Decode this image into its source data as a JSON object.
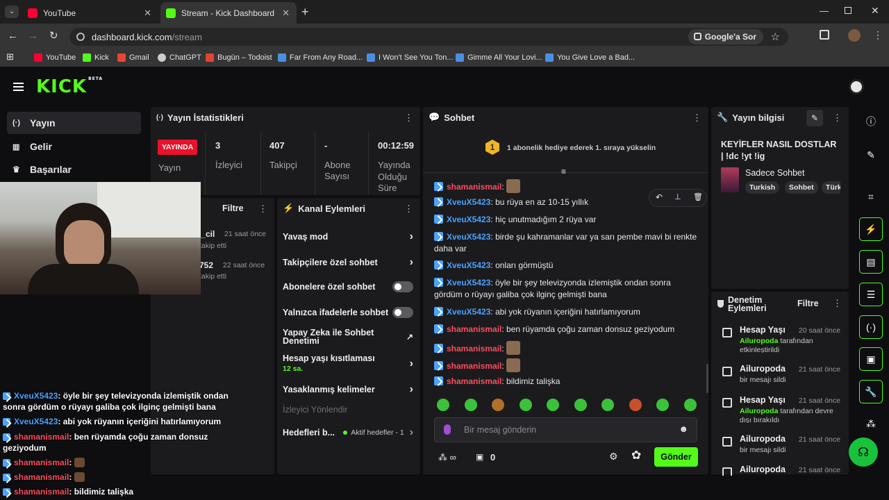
{
  "browser": {
    "tabs": [
      {
        "title": "YouTube",
        "active": false
      },
      {
        "title": "Stream - Kick Dashboard",
        "active": true
      }
    ],
    "url_host": "dashboard.kick.com",
    "url_path": "/stream",
    "ask_google": "Google'a Sor",
    "bookmarks": [
      "YouTube",
      "Kick",
      "Gmail",
      "ChatGPT",
      "Bugün – Todoist",
      "Far From Any Road...",
      "I Won't See You Ton...",
      "Gimme All Your Lovi...",
      "You Give Love a Bad..."
    ]
  },
  "brand": {
    "logo": "KICK",
    "badge": "BETA",
    "accent": "#53fc18"
  },
  "sidebar": {
    "items": [
      {
        "label": "Yayın",
        "icon": "broadcast-icon"
      },
      {
        "label": "Gelir",
        "icon": "chart-icon"
      },
      {
        "label": "Başarılar",
        "icon": "trophy-icon"
      }
    ]
  },
  "stats": {
    "title": "Yayın İstatistikleri",
    "live_badge": "YAYINDA",
    "live_label": "Yayın",
    "viewers_value": "3",
    "viewers_label": "İzleyici",
    "followers_value": "407",
    "followers_label": "Takipçi",
    "subs_value": "-",
    "subs_label": "Abone Sayısı",
    "uptime_value": "00:12:59",
    "uptime_label": "Yayında Olduğu Süre"
  },
  "activity": {
    "filter": "Filtre",
    "items": [
      {
        "name": "n_cil",
        "time": "21 saat önce",
        "desc": "takip etti"
      },
      {
        "name": "752",
        "time": "22 saat önce",
        "desc": "takip etti"
      }
    ]
  },
  "channel_actions": {
    "title": "Kanal Eylemleri",
    "slow_mode": "Yavaş mod",
    "followers_only": "Takipçilere özel sohbet",
    "subs_only": "Abonelere özel sohbet",
    "emotes_only": "Yalnızca ifadelerle sohbet",
    "ai_moderation": "Yapay Zeka ile Sohbet Denetimi",
    "account_age": "Hesap yaşı kısıtlaması",
    "account_age_value": "12 sa.",
    "banned_words": "Yasaklanmış kelimeler",
    "viewer_redirect": "İzleyici Yönlendir",
    "goals": "Hedefleri b...",
    "goals_status": "Aktif hedefler - 1"
  },
  "chat": {
    "title": "Sohbet",
    "gift_rank": "1",
    "gift_banner": "1 abonelik hediye ederek 1. sıraya yükselin",
    "messages": [
      {
        "user": "shamanismail",
        "text": "",
        "color": "red"
      },
      {
        "user": "XveuX5423",
        "text": "bu rüya en az 10-15 yıllık",
        "color": "blue"
      },
      {
        "user": "XveuX5423",
        "text": "hiç unutmadığım 2 rüya var",
        "color": "blue"
      },
      {
        "user": "XveuX5423",
        "text": "birde şu kahramanlar var ya sarı pembe mavi bi renkte daha var",
        "color": "blue"
      },
      {
        "user": "XveuX5423",
        "text": "onları görmüştü",
        "color": "blue"
      },
      {
        "user": "XveuX5423",
        "text": "öyle bir şey televizyonda izlemiştik ondan sonra gördüm o rüyayı galiba çok ilginç gelmişti bana",
        "color": "blue"
      },
      {
        "user": "XveuX5423",
        "text": "abi yok rüyanın içeriğini hatırlamıyorum",
        "color": "blue"
      },
      {
        "user": "shamanismail",
        "text": "ben rüyamda çoğu zaman donsuz geziyodum",
        "color": "red"
      },
      {
        "user": "shamanismail",
        "text": "",
        "color": "red"
      },
      {
        "user": "shamanismail",
        "text": "",
        "color": "red"
      },
      {
        "user": "shamanismail",
        "text": "bildimiz talişka",
        "color": "red"
      }
    ],
    "input_placeholder": "Bir mesaj gönderin",
    "points": "0",
    "send_label": "Gönder"
  },
  "overlay_chat": [
    {
      "user": "XveuX5423",
      "text": "öyle bir şey televizyonda izlemiştik ondan sonra gördüm o rüyayı galiba çok ilginç gelmişti bana",
      "color": "blue"
    },
    {
      "user": "XveuX5423",
      "text": "abi yok rüyanın içeriğini hatırlamıyorum",
      "color": "blue"
    },
    {
      "user": "shamanismail",
      "text": "ben rüyamda çoğu zaman donsuz geziyodum",
      "color": "red"
    },
    {
      "user": "shamanismail",
      "text": "",
      "color": "red"
    },
    {
      "user": "shamanismail",
      "text": "",
      "color": "red"
    },
    {
      "user": "shamanismail",
      "text": "bildimiz talişka",
      "color": "red"
    }
  ],
  "stream_info": {
    "title": "Yayın bilgisi",
    "stream_title": "KEYİFLER NASIL DOSTLAR | !dc !yt !ig",
    "category": "Sadece Sohbet",
    "tags": [
      "Turkish",
      "Sohbet",
      "Türk"
    ]
  },
  "moderation": {
    "title": "Denetim Eylemleri",
    "filter": "Filtre",
    "items": [
      {
        "title": "Hesap Yaşı",
        "time": "20 saat önce",
        "actor": "Ailuropoda",
        "desc": "tarafından etkinleştirildi"
      },
      {
        "title": "Ailuropoda",
        "time": "21 saat önce",
        "actor": "",
        "desc": "bir mesajı sildi"
      },
      {
        "title": "Hesap Yaşı",
        "time": "21 saat önce",
        "actor": "Ailuropoda",
        "desc": "tarafından devre dışı bırakıldı"
      },
      {
        "title": "Ailuropoda",
        "time": "21 saat önce",
        "actor": "",
        "desc": "bir mesajı sildi"
      },
      {
        "title": "Ailuropoda",
        "time": "21 saat önce",
        "actor": "",
        "desc": ""
      }
    ]
  }
}
